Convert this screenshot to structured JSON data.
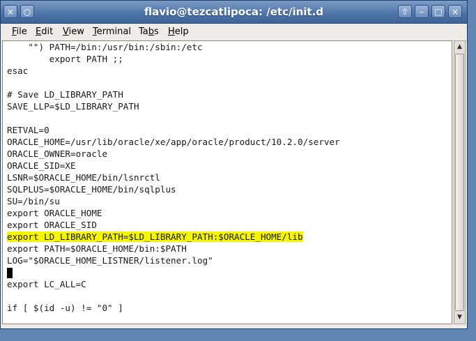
{
  "window": {
    "title": "flavio@tezcatlipoca: /etc/init.d",
    "buttons": {
      "menu": "×",
      "pin": "○",
      "up": "⇧",
      "minimize": "–",
      "maximize": "□",
      "close": "×"
    }
  },
  "menubar": {
    "items": [
      {
        "label": "File",
        "mnemonic": "F",
        "rest": "ile"
      },
      {
        "label": "Edit",
        "mnemonic": "E",
        "rest": "dit"
      },
      {
        "label": "View",
        "mnemonic": "V",
        "rest": "iew"
      },
      {
        "label": "Terminal",
        "mnemonic": "T",
        "rest": "erminal"
      },
      {
        "label": "Tabs",
        "mnemonic": "b",
        "pre": "Ta",
        "rest": "s"
      },
      {
        "label": "Help",
        "mnemonic": "H",
        "rest": "elp"
      }
    ]
  },
  "terminal": {
    "lines": [
      "    \"\") PATH=/bin:/usr/bin:/sbin:/etc",
      "        export PATH ;;",
      "esac",
      "",
      "# Save LD_LIBRARY_PATH",
      "SAVE_LLP=$LD_LIBRARY_PATH",
      "",
      "RETVAL=0",
      "ORACLE_HOME=/usr/lib/oracle/xe/app/oracle/product/10.2.0/server",
      "ORACLE_OWNER=oracle",
      "ORACLE_SID=XE",
      "LSNR=$ORACLE_HOME/bin/lsnrctl",
      "SQLPLUS=$ORACLE_HOME/bin/sqlplus",
      "SU=/bin/su",
      "export ORACLE_HOME",
      "export ORACLE_SID",
      "export LD_LIBRARY_PATH=$LD_LIBRARY_PATH:$ORACLE_HOME/lib",
      "export PATH=$ORACLE_HOME/bin:$PATH",
      "LOG=\"$ORACLE_HOME_LISTNER/listener.log\"",
      "",
      "export LC_ALL=C",
      "",
      "if [ $(id -u) != \"0\" ]"
    ],
    "highlighted_line": 16,
    "cursor_line": 19
  },
  "colors": {
    "highlight": "#f5f500",
    "titlebar": "#4f76a9",
    "desktop": "#5f86b3"
  }
}
